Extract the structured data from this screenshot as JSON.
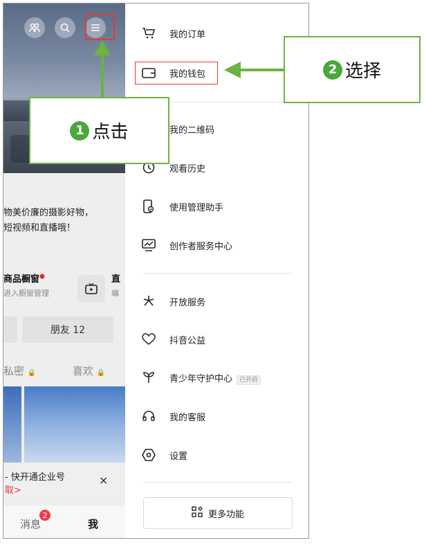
{
  "background_app": {
    "intro_line1": "物美价廉的摄影好物，",
    "intro_line2": "短视频和直播哦！",
    "shop_title": "商品橱窗",
    "shop_sub": "进入橱窗管理",
    "live_title": "直",
    "edit_sub": "编",
    "friends_label": "朋友 12",
    "tab_private": "私密",
    "tab_likes": "喜欢",
    "promo_line1": "- 快开通企业号",
    "promo_line2": "取>",
    "promo_close": "×",
    "nav_messages": "消息",
    "nav_messages_badge": "2",
    "nav_me": "我",
    "icons": [
      "friends-icon",
      "search-icon",
      "menu-icon"
    ]
  },
  "drawer": {
    "items": [
      {
        "label": "我的订单",
        "icon": "cart-icon"
      },
      {
        "label": "我的钱包",
        "icon": "wallet-icon"
      },
      {
        "label": "我的二维码",
        "icon": "qrcode-icon"
      },
      {
        "label": "观看历史",
        "icon": "clock-icon"
      },
      {
        "label": "使用管理助手",
        "icon": "phone-check-icon"
      },
      {
        "label": "创作者服务中心",
        "icon": "chart-icon"
      },
      {
        "label": "开放服务",
        "icon": "asterisk-icon"
      },
      {
        "label": "抖音公益",
        "icon": "heart-icon"
      },
      {
        "label": "青少年守护中心",
        "icon": "sprout-icon",
        "tag": "已开启"
      },
      {
        "label": "我的客服",
        "icon": "headset-icon"
      },
      {
        "label": "设置",
        "icon": "settings-icon"
      }
    ],
    "more_label": "更多功能"
  },
  "annotations": {
    "step1_num": "1",
    "step1_text": "点击",
    "step2_num": "2",
    "step2_text": "选择",
    "accent_color": "#6cb33f",
    "highlight_color": "#e23a3a"
  }
}
